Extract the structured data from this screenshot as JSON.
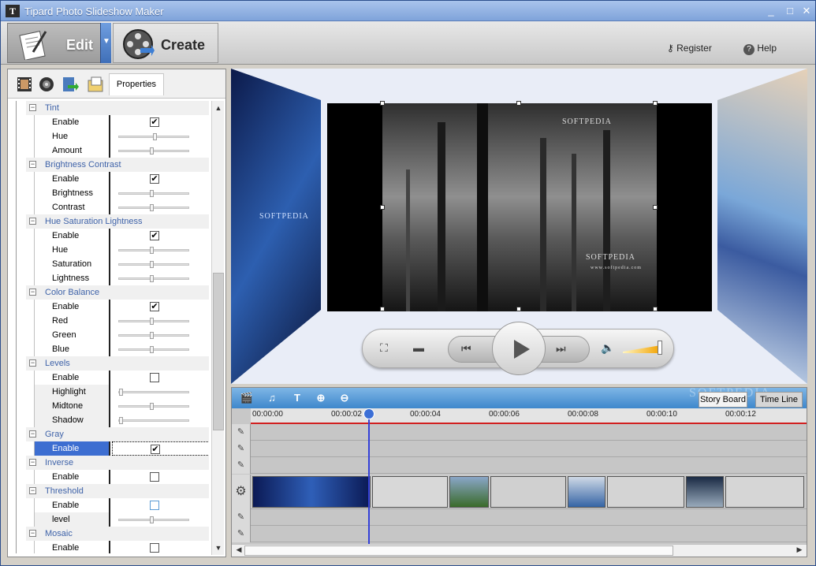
{
  "window": {
    "title": "Tipard Photo Slideshow Maker",
    "min": "_",
    "max": "□",
    "close": "✕",
    "app_icon": "T"
  },
  "toolbar": {
    "edit_label": "Edit",
    "create_label": "Create",
    "register_label": "Register",
    "help_label": "Help",
    "dropdown_arrow": "▼"
  },
  "left_tabs": {
    "properties_label": "Properties"
  },
  "properties": [
    {
      "group": "Tint",
      "rows": [
        {
          "name": "Enable",
          "type": "check",
          "value": true
        },
        {
          "name": "Hue",
          "type": "slider",
          "value": 0.5
        },
        {
          "name": "Amount",
          "type": "slider",
          "value": 0.45
        }
      ]
    },
    {
      "group": "Brightness Contrast",
      "rows": [
        {
          "name": "Enable",
          "type": "check",
          "value": true
        },
        {
          "name": "Brightness",
          "type": "slider",
          "value": 0.45
        },
        {
          "name": "Contrast",
          "type": "slider",
          "value": 0.45
        }
      ]
    },
    {
      "group": "Hue Saturation Lightness",
      "rows": [
        {
          "name": "Enable",
          "type": "check",
          "value": true
        },
        {
          "name": "Hue",
          "type": "slider",
          "value": 0.45
        },
        {
          "name": "Saturation",
          "type": "slider",
          "value": 0.45
        },
        {
          "name": "Lightness",
          "type": "slider",
          "value": 0.45
        }
      ]
    },
    {
      "group": "Color Balance",
      "rows": [
        {
          "name": "Enable",
          "type": "check",
          "value": true
        },
        {
          "name": "Red",
          "type": "slider",
          "value": 0.45
        },
        {
          "name": "Green",
          "type": "slider",
          "value": 0.45
        },
        {
          "name": "Blue",
          "type": "slider",
          "value": 0.45
        }
      ]
    },
    {
      "group": "Levels",
      "rows": [
        {
          "name": "Enable",
          "type": "check",
          "value": false
        },
        {
          "name": "Highlight",
          "type": "slider",
          "value": 0.0,
          "disabled": true
        },
        {
          "name": "Midtone",
          "type": "slider",
          "value": 0.45,
          "disabled": true
        },
        {
          "name": "Shadow",
          "type": "slider",
          "value": 0.0,
          "disabled": true
        }
      ]
    },
    {
      "group": "Gray",
      "rows": [
        {
          "name": "Enable",
          "type": "check",
          "value": true,
          "selected": true
        }
      ]
    },
    {
      "group": "Inverse",
      "rows": [
        {
          "name": "Enable",
          "type": "check",
          "value": false
        }
      ]
    },
    {
      "group": "Threshold",
      "rows": [
        {
          "name": "Enable",
          "type": "check",
          "value": false,
          "blue": true
        },
        {
          "name": "level",
          "type": "slider",
          "value": 0.45,
          "disabled": true
        }
      ]
    },
    {
      "group": "Mosaic",
      "rows": [
        {
          "name": "Enable",
          "type": "check",
          "value": false
        }
      ]
    }
  ],
  "group_toggle": "−",
  "preview": {
    "watermark_main": "SOFTPEDIA",
    "watermark_tm": "®",
    "watermark_sub": "www.softpedia.com"
  },
  "timeline": {
    "story_board_label": "Story Board",
    "time_line_label": "Time Line",
    "watermark": "SOFTPEDIA",
    "ticks": [
      "00:00:00",
      "00:00:02",
      "00:00:04",
      "00:00:06",
      "00:00:08",
      "00:00:10",
      "00:00:12"
    ],
    "playhead_fraction": 0.212
  },
  "colors": {
    "accent": "#3d6ed1",
    "group_text": "#3f63a9",
    "timeline_bar": "#3e87cc",
    "ruler_red": "#d12020"
  },
  "icons": [
    "film-icon",
    "music-icon",
    "transition-icon",
    "properties-icon",
    "register-key-icon",
    "help-icon",
    "add-video-icon",
    "add-music-icon",
    "add-text-icon",
    "zoom-in-icon",
    "zoom-out-icon"
  ]
}
